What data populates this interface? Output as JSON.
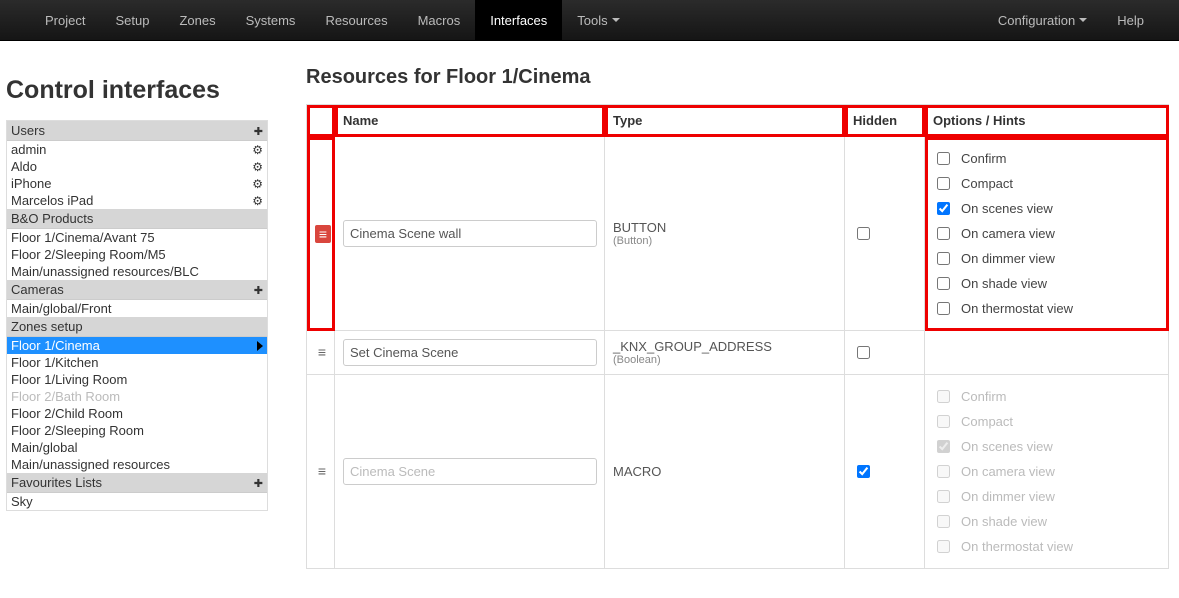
{
  "nav": {
    "left": [
      "Project",
      "Setup",
      "Zones",
      "Systems",
      "Resources",
      "Macros",
      "Interfaces",
      "Tools"
    ],
    "activeIndex": 6,
    "toolsHasDropdown": true,
    "right": {
      "configuration": "Configuration",
      "help": "Help"
    }
  },
  "left": {
    "title": "Control interfaces",
    "sections": [
      {
        "header": "Users",
        "add": true,
        "items": [
          {
            "label": "admin",
            "gear": true
          },
          {
            "label": "Aldo",
            "gear": true
          },
          {
            "label": "iPhone",
            "gear": true
          },
          {
            "label": "Marcelos iPad",
            "gear": true
          }
        ]
      },
      {
        "header": "B&O Products",
        "add": false,
        "items": [
          {
            "label": "Floor 1/Cinema/Avant 75"
          },
          {
            "label": "Floor 2/Sleeping Room/M5"
          },
          {
            "label": "Main/unassigned resources/BLC"
          }
        ]
      },
      {
        "header": "Cameras",
        "add": true,
        "items": [
          {
            "label": "Main/global/Front"
          }
        ]
      },
      {
        "header": "Zones setup",
        "add": false,
        "items": [
          {
            "label": "Floor 1/Cinema",
            "selected": true,
            "arrow": true
          },
          {
            "label": "Floor 1/Kitchen"
          },
          {
            "label": "Floor 1/Living Room"
          },
          {
            "label": "Floor 2/Bath Room",
            "dim": true
          },
          {
            "label": "Floor 2/Child Room"
          },
          {
            "label": "Floor 2/Sleeping Room"
          },
          {
            "label": "Main/global"
          },
          {
            "label": "Main/unassigned resources"
          }
        ]
      },
      {
        "header": "Favourites Lists",
        "add": true,
        "items": [
          {
            "label": "Sky"
          }
        ]
      }
    ]
  },
  "content": {
    "title": "Resources for Floor 1/Cinema",
    "columns": {
      "name": "Name",
      "type": "Type",
      "hidden": "Hidden",
      "options": "Options / Hints"
    },
    "optionLabels": [
      "Confirm",
      "Compact",
      "On scenes view",
      "On camera view",
      "On dimmer view",
      "On shade view",
      "On thermostat view"
    ],
    "rows": [
      {
        "handleRed": true,
        "name": "Cinema Scene wall",
        "type": "BUTTON",
        "typeSub": "(Button)",
        "hidden": false,
        "optionsChecked": [
          false,
          false,
          true,
          false,
          false,
          false,
          false
        ],
        "optionsDim": false,
        "highlightOptions": true
      },
      {
        "handleRed": false,
        "name": "Set Cinema Scene",
        "type": "_KNX_GROUP_ADDRESS",
        "typeSub": "(Boolean)",
        "hidden": false,
        "optionsChecked": null,
        "optionsDim": false
      },
      {
        "handleRed": false,
        "name": "Cinema Scene",
        "nameDim": true,
        "type": "MACRO",
        "typeSub": "",
        "typeDim": true,
        "hidden": true,
        "optionsChecked": [
          false,
          false,
          true,
          false,
          false,
          false,
          false
        ],
        "optionsDim": true
      }
    ]
  }
}
